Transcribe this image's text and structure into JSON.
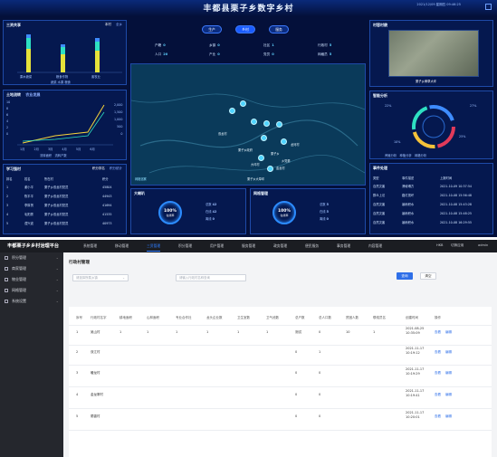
{
  "dashboard": {
    "title": "丰都县栗子乡数字乡村",
    "clock": "2021/12/09 星期四 09:46:25",
    "nav": [
      "生产",
      "乡村",
      "服务"
    ],
    "stats": [
      {
        "label": "户籍",
        "value": "0"
      },
      {
        "label": "乡镇",
        "value": "0"
      },
      {
        "label": "社区",
        "value": "1"
      },
      {
        "label": "行政村",
        "value": "5"
      },
      {
        "label": "人口",
        "value": "20"
      },
      {
        "label": "产业",
        "value": "0"
      },
      {
        "label": "党员",
        "value": "0"
      },
      {
        "label": "网格员",
        "value": "5"
      }
    ],
    "left_top": {
      "title": "三资共享",
      "tabs": [
        "本村",
        "全乡"
      ],
      "categories": [
        "果木蔬菜",
        "粮食作物",
        "畜牧业"
      ],
      "legend": [
        "蔬菜",
        "水果",
        "粮食"
      ]
    },
    "left_mid": {
      "title": "土地流转",
      "tab2": "农业发展",
      "y_left": [
        "10",
        "8",
        "6",
        "4",
        "2",
        "0"
      ],
      "y_right": [
        "2,000",
        "1,500",
        "1,000",
        "500",
        "0"
      ],
      "x": [
        "1月",
        "2月",
        "3月",
        "4月",
        "5月",
        "6月"
      ],
      "legend": [
        "流转面积",
        "流转户数"
      ]
    },
    "left_bottom": {
      "title": "学习强村",
      "tabs": [
        "积分排名",
        "积分统计"
      ],
      "headers": [
        "排名",
        "姓名",
        "所在村",
        "积分"
      ],
      "rows": [
        [
          "1",
          "谢小平",
          "栗子乡双龙村党员",
          "45804"
        ],
        [
          "2",
          "陈平平",
          "栗子乡双龙村党员",
          "44943"
        ],
        [
          "3",
          "李厚贤",
          "栗子乡双龙村党员",
          "41694"
        ],
        [
          "4",
          "毛阳秀",
          "栗子乡双龙村党员",
          "41535"
        ],
        [
          "5",
          "谭兴波",
          "栗子乡双龙村党员",
          "40973"
        ]
      ]
    },
    "right_top": {
      "title": "村容村貌",
      "caption": "栗子乡黄草大坪"
    },
    "right_mid": {
      "title": "智能分析",
      "labels": [
        "22%",
        "27%",
        "10%",
        "25%"
      ],
      "legend": [
        "养殖分析",
        "种植分析",
        "网格分析"
      ]
    },
    "right_bottom": {
      "title": "事件处理",
      "headers": [
        "类型",
        "事件描述",
        "上报时间"
      ],
      "rows": [
        [
          "自然灾害",
          "滑坡塌方",
          "2021-10-09 10:37:54"
        ],
        [
          "群众上访",
          "路灯损坏",
          "2021-10-08 15:56:48"
        ],
        [
          "自然灾害",
          "暴雨积水",
          "2021-10-08 15:43:28"
        ],
        [
          "自然灾害",
          "暴雨积水",
          "2021-10-08 15:48:25"
        ],
        [
          "自然灾害",
          "暴雨积水",
          "2021-10-08 16:29:55"
        ]
      ]
    },
    "map_labels": [
      "双龙村",
      "龙河村",
      "栗子乡政府",
      "栗子乡",
      "乡党委",
      "金龙村",
      "大坪村",
      "栗子乡大草坪"
    ],
    "bottom_left": {
      "title": "大喇叭",
      "gauge_value": "100%",
      "gauge_text": "在线率",
      "rows": [
        [
          "总数",
          "42"
        ],
        [
          "在线",
          "42"
        ],
        [
          "离线",
          "0"
        ]
      ]
    },
    "bottom_right": {
      "title": "网格管理",
      "gauge_value": "100%",
      "gauge_text": "在线率",
      "rows": [
        [
          "总数",
          "5"
        ],
        [
          "在线",
          "5"
        ],
        [
          "离线",
          "0"
        ]
      ]
    },
    "map_legend": "网格巡察"
  },
  "app": {
    "brand": "丰都栗子乡乡村治理平台",
    "menu": [
      "系统管理",
      "移动管理",
      "三资管理",
      "积分管理",
      "用户管理",
      "服务管理",
      "政务管理",
      "便民服务",
      "事务管理",
      "内容管理"
    ],
    "active_menu_index": 2,
    "right": [
      "HKB",
      "切换应用",
      "admin"
    ],
    "sidebar": [
      "积分管理",
      "商家管理",
      "物业管理",
      "网格管理",
      "系统设置"
    ],
    "page_title": "行政村管理",
    "filter1_placeholder": "请选择所属乡镇",
    "filter2_placeholder": "请输入行政村名称查询",
    "search_btn": "查询",
    "reset_btn": "清空",
    "columns": [
      "序号",
      "行政村名字",
      "耕地面积",
      "山林面积",
      "专业合作社",
      "龙头企业数",
      "卫生室数",
      "卫气池数",
      "总户数",
      "总人口数",
      "贫困人数",
      "联络员名",
      "创建时间",
      "操作"
    ],
    "rows": [
      [
        "1",
        "吴山村",
        "1",
        "1",
        "1",
        "1",
        "1",
        "1",
        "测试",
        "0",
        "10",
        "1",
        "2021-08-25 10:35:09"
      ],
      [
        "2",
        "双江村",
        "",
        "",
        "",
        "",
        "",
        "",
        "0",
        "1",
        "",
        "",
        "2021-11-17 10:19:12"
      ],
      [
        "3",
        "暖龙村",
        "",
        "",
        "",
        "",
        "",
        "",
        "0",
        "0",
        "",
        "",
        "2021-11-17 10:19:29"
      ],
      [
        "4",
        "金龙寨村",
        "",
        "",
        "",
        "",
        "",
        "",
        "0",
        "0",
        "",
        "",
        "2021-11-17 10:19:41"
      ],
      [
        "5",
        "荫香村",
        "",
        "",
        "",
        "",
        "",
        "",
        "0",
        "0",
        "",
        "",
        "2021-11-17 10:20:01"
      ]
    ],
    "actions": [
      "查看",
      "编辑"
    ]
  }
}
